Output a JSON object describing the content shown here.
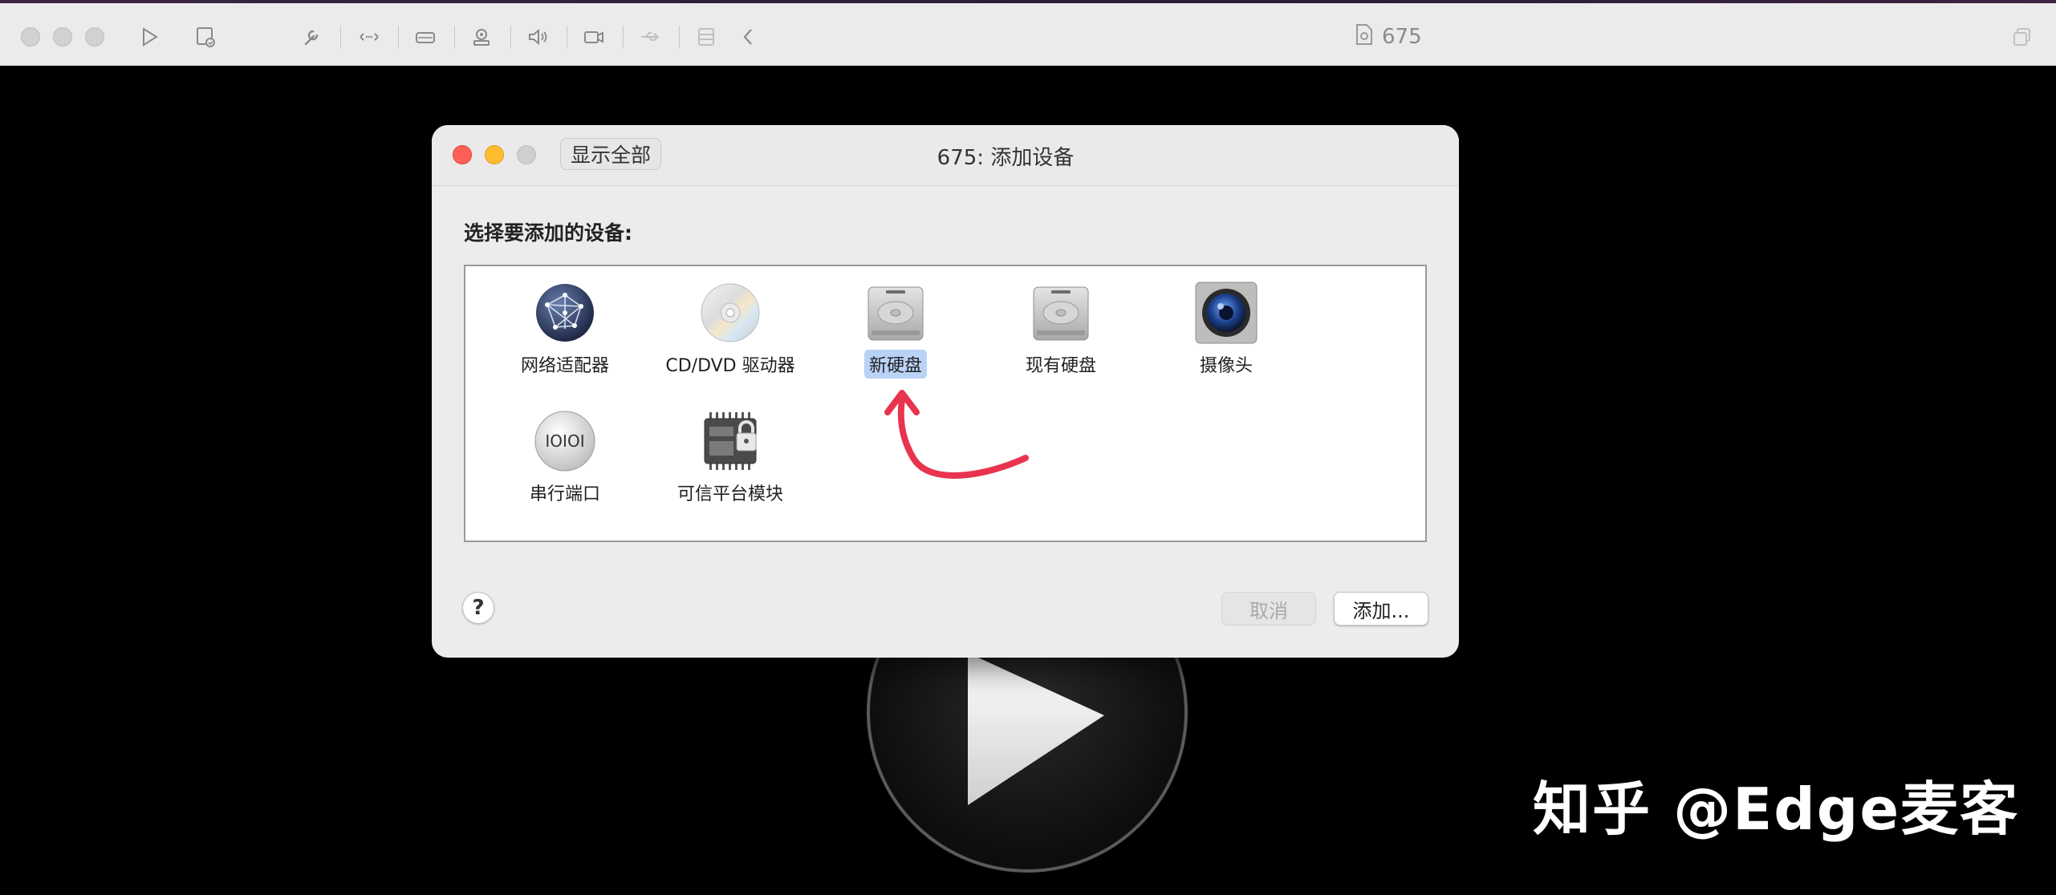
{
  "toolbar": {
    "document_title": "675"
  },
  "dialog": {
    "show_all_label": "显示全部",
    "title": "675: 添加设备",
    "prompt": "选择要添加的设备:",
    "devices": [
      {
        "label": "网络适配器",
        "icon": "network-globe-icon"
      },
      {
        "label": "CD/DVD 驱动器",
        "icon": "cd-dvd-icon"
      },
      {
        "label": "新硬盘",
        "icon": "hard-disk-icon",
        "selected": true
      },
      {
        "label": "现有硬盘",
        "icon": "hard-disk-icon"
      },
      {
        "label": "摄像头",
        "icon": "camera-icon"
      },
      {
        "label": "串行端口",
        "icon": "serial-port-icon"
      },
      {
        "label": "可信平台模块",
        "icon": "tpm-chip-lock-icon"
      }
    ],
    "help_label": "?",
    "cancel_label": "取消",
    "add_label": "添加..."
  },
  "watermark": "知乎 @Edge麦客",
  "colors": {
    "close": "#ff5f57",
    "minimize": "#febc2e",
    "zoom_inactive": "#cfcfcf",
    "selection": "#b8d3f5",
    "annotation_arrow": "#e8344e"
  }
}
